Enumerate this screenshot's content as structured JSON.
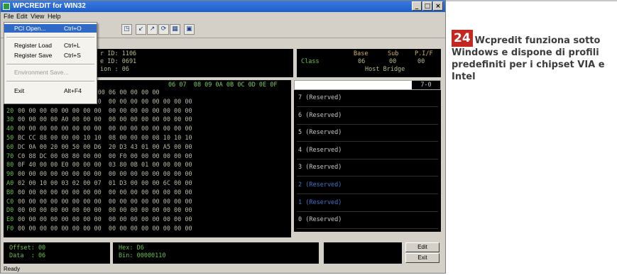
{
  "window": {
    "title": "WPCREDIT for WIN32",
    "buttons": [
      "_",
      "□",
      "×"
    ]
  },
  "menubar": [
    "File",
    "Edit",
    "View",
    "Help"
  ],
  "file_menu": [
    {
      "label": "PCI Open...",
      "accel": "Ctrl+O",
      "state": "selected"
    },
    {
      "label": "Register Load",
      "accel": "Ctrl+L",
      "state": "normal"
    },
    {
      "label": "Register Save",
      "accel": "Ctrl+S",
      "state": "normal"
    },
    {
      "label": "Environment Save...",
      "accel": "",
      "state": "disabled"
    },
    {
      "label": "Exit",
      "accel": "Alt+F4",
      "state": "normal"
    }
  ],
  "toolbar_icons": [
    "pci-open-icon",
    "register-load-icon",
    "register-save-icon",
    "refresh-icon",
    "grid-view-icon",
    "chip-icon"
  ],
  "device_info": {
    "lines": [
      "r ID: 1106",
      "e ID: 0691",
      "ion : 06"
    ]
  },
  "class_info": {
    "headers": [
      "Base",
      "Sub",
      "P.I/F"
    ],
    "label": "Class",
    "values": [
      "06",
      "00",
      "00"
    ],
    "description": "Host Bridge"
  },
  "hex_header": "06 07  08 09 0A 0B 0C 0D 0E 0F",
  "hex_rows": [
    {
      "addr": "",
      "hex": "         90 A2  06 00 00 06 00 00 00 00"
    },
    {
      "addr": "10",
      "hex": "08 00 00 DE 00 00 00 00  00 00 00 00 00 00 00 00"
    },
    {
      "addr": "20",
      "hex": "00 00 00 00 00 00 00 00  00 00 00 00 00 00 00 00"
    },
    {
      "addr": "30",
      "hex": "00 00 00 00 A0 00 00 00  00 00 00 00 00 00 00 00"
    },
    {
      "addr": "40",
      "hex": "00 00 00 00 00 00 00 00  00 00 00 00 00 00 00 00"
    },
    {
      "addr": "50",
      "hex": "BC CC 88 00 00 00 10 10  08 00 00 00 08 10 10 10"
    },
    {
      "addr": "60",
      "hex": "DC 0A 00 20 00 50 00 D6  20 D3 43 01 00 A5 00 00"
    },
    {
      "addr": "70",
      "hex": "C0 88 DC 00 08 80 00 00  00 F0 00 00 00 00 00 00"
    },
    {
      "addr": "80",
      "hex": "0F 40 00 00 E0 00 00 00  03 80 0B 01 00 00 00 00"
    },
    {
      "addr": "90",
      "hex": "00 00 00 00 00 00 00 00  00 00 00 00 00 00 00 00"
    },
    {
      "addr": "A0",
      "hex": "02 00 10 00 03 02 00 07  01 D3 00 00 00 6C 00 00"
    },
    {
      "addr": "B0",
      "hex": "00 00 00 00 00 00 00 00  00 00 00 00 00 00 00 00"
    },
    {
      "addr": "C0",
      "hex": "00 00 00 00 00 00 00 00  00 00 00 00 00 00 00 00"
    },
    {
      "addr": "D0",
      "hex": "00 00 00 00 00 00 00 00  00 00 00 00 00 00 00 00"
    },
    {
      "addr": "E0",
      "hex": "00 00 00 00 00 00 00 00  00 00 00 00 00 00 00 00"
    },
    {
      "addr": "F0",
      "hex": "00 00 00 00 00 00 00 00  00 00 00 00 00 00 00 00"
    }
  ],
  "bit_panel": {
    "header": "7-0",
    "rows": [
      {
        "text": "7 (Reserved)",
        "color": "#c8c8c8"
      },
      {
        "text": "6 (Reserved)",
        "color": "#c8c8c8"
      },
      {
        "text": "5 (Reserved)",
        "color": "#c8c8c8"
      },
      {
        "text": "4 (Reserved)",
        "color": "#c8c8c8"
      },
      {
        "text": "3 (Reserved)",
        "color": "#c8c8c8"
      },
      {
        "text": "2 (Reserved)",
        "color": "#3e74c8"
      },
      {
        "text": "1 (Reserved)",
        "color": "#3e74c8"
      },
      {
        "text": "0 (Reserved)",
        "color": "#c8c8c8"
      }
    ]
  },
  "offset_panel": {
    "offset": "Offset: 00",
    "data": "Data  : 06"
  },
  "value_panel": {
    "hex": "Hex: D6",
    "bin": "Bin: 00000110"
  },
  "buttons": {
    "edit": "Edit",
    "exit": "Exit"
  },
  "status_text": "Ready",
  "caption": {
    "number": "24",
    "text": "Wcpredit funziona sotto Windows e dispone di profili predefiniti per i chipset VIA e Intel"
  },
  "colors": {
    "titlebar": "#1e5ec8",
    "menu_highlight": "#316ac5",
    "badge": "#c4271f",
    "hex_text": "#b8b8a8",
    "address_green": "#6abf4b"
  }
}
